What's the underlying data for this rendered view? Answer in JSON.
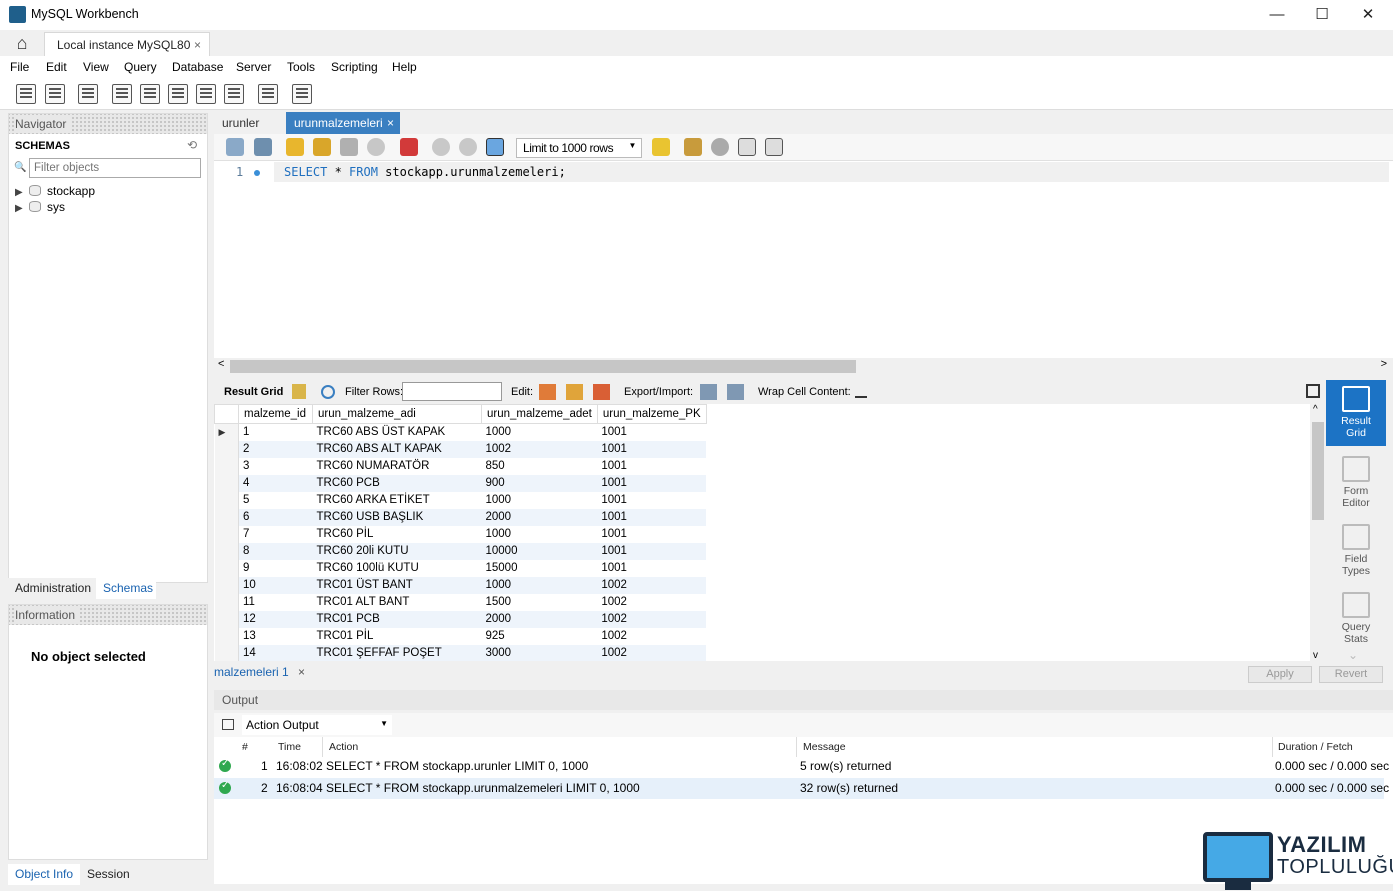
{
  "window": {
    "title": "MySQL Workbench",
    "minimize": "—",
    "maximize": "☐",
    "close": "✕"
  },
  "connection_tab": {
    "label": "Local instance MySQL80",
    "close": "×"
  },
  "menu": [
    "File",
    "Edit",
    "View",
    "Query",
    "Database",
    "Server",
    "Tools",
    "Scripting",
    "Help"
  ],
  "navigator": {
    "header": "Navigator",
    "schemas_label": "SCHEMAS",
    "filter_placeholder": "Filter objects",
    "schemas": [
      "stockapp",
      "sys"
    ],
    "tabs": [
      "Administration",
      "Schemas"
    ]
  },
  "information": {
    "header": "Information",
    "message": "No object selected",
    "tabs": [
      "Object Info",
      "Session"
    ]
  },
  "editor": {
    "tabs": [
      "urunler",
      "urunmalzemeleri"
    ],
    "tab_close": "×",
    "limit": "Limit to 1000 rows",
    "line_number": "1",
    "sql": {
      "kw1": "SELECT",
      "mid": " * ",
      "kw2": "FROM",
      "rest": " stockapp.urunmalzemeleri;"
    }
  },
  "result_toolbar": {
    "result_grid": "Result Grid",
    "filter_rows": "Filter Rows:",
    "edit": "Edit:",
    "export_import": "Export/Import:",
    "wrap": "Wrap Cell Content:"
  },
  "grid": {
    "columns": [
      "malzeme_id",
      "urun_malzeme_adi",
      "urun_malzeme_adet",
      "urun_malzeme_PK"
    ],
    "rows": [
      [
        "1",
        "TRC60 ABS ÜST KAPAK",
        "1000",
        "1001"
      ],
      [
        "2",
        "TRC60 ABS ALT KAPAK",
        "1002",
        "1001"
      ],
      [
        "3",
        "TRC60 NUMARATÖR",
        "850",
        "1001"
      ],
      [
        "4",
        "TRC60 PCB",
        "900",
        "1001"
      ],
      [
        "5",
        "TRC60 ARKA ETİKET",
        "1000",
        "1001"
      ],
      [
        "6",
        "TRC60 USB BAŞLIK",
        "2000",
        "1001"
      ],
      [
        "7",
        "TRC60 PİL",
        "1000",
        "1001"
      ],
      [
        "8",
        "TRC60 20li KUTU",
        "10000",
        "1001"
      ],
      [
        "9",
        "TRC60 100lü KUTU",
        "15000",
        "1001"
      ],
      [
        "10",
        "TRC01 ÜST BANT",
        "1000",
        "1002"
      ],
      [
        "11",
        "TRC01 ALT BANT",
        "1500",
        "1002"
      ],
      [
        "12",
        "TRC01 PCB",
        "2000",
        "1002"
      ],
      [
        "13",
        "TRC01 PİL",
        "925",
        "1002"
      ],
      [
        "14",
        "TRC01 ŞEFFAF POŞET",
        "3000",
        "1002"
      ]
    ]
  },
  "side_panel": [
    {
      "line1": "Result",
      "line2": "Grid"
    },
    {
      "line1": "Form",
      "line2": "Editor"
    },
    {
      "line1": "Field",
      "line2": "Types"
    },
    {
      "line1": "Query",
      "line2": "Stats"
    }
  ],
  "result_tab": {
    "label": "malzemeleri 1",
    "close": "×"
  },
  "buttons": {
    "apply": "Apply",
    "revert": "Revert"
  },
  "output": {
    "header": "Output",
    "selector": "Action Output",
    "columns": [
      "#",
      "Time",
      "Action",
      "Message",
      "Duration / Fetch"
    ],
    "rows": [
      {
        "n": "1",
        "time": "16:08:02",
        "action": "SELECT * FROM stockapp.urunler LIMIT 0, 1000",
        "message": "5 row(s) returned",
        "duration": "0.000 sec / 0.000 sec"
      },
      {
        "n": "2",
        "time": "16:08:04",
        "action": "SELECT * FROM stockapp.urunmalzemeleri LIMIT 0, 1000",
        "message": "32 row(s) returned",
        "duration": "0.000 sec / 0.000 sec"
      }
    ]
  },
  "watermark": {
    "line1": "YAZILIM",
    "line2": "TOPLULUĞU"
  },
  "colors": {
    "accent": "#1c73c5",
    "tab_active": "#3a7fc1",
    "ok": "#2fa84f"
  }
}
